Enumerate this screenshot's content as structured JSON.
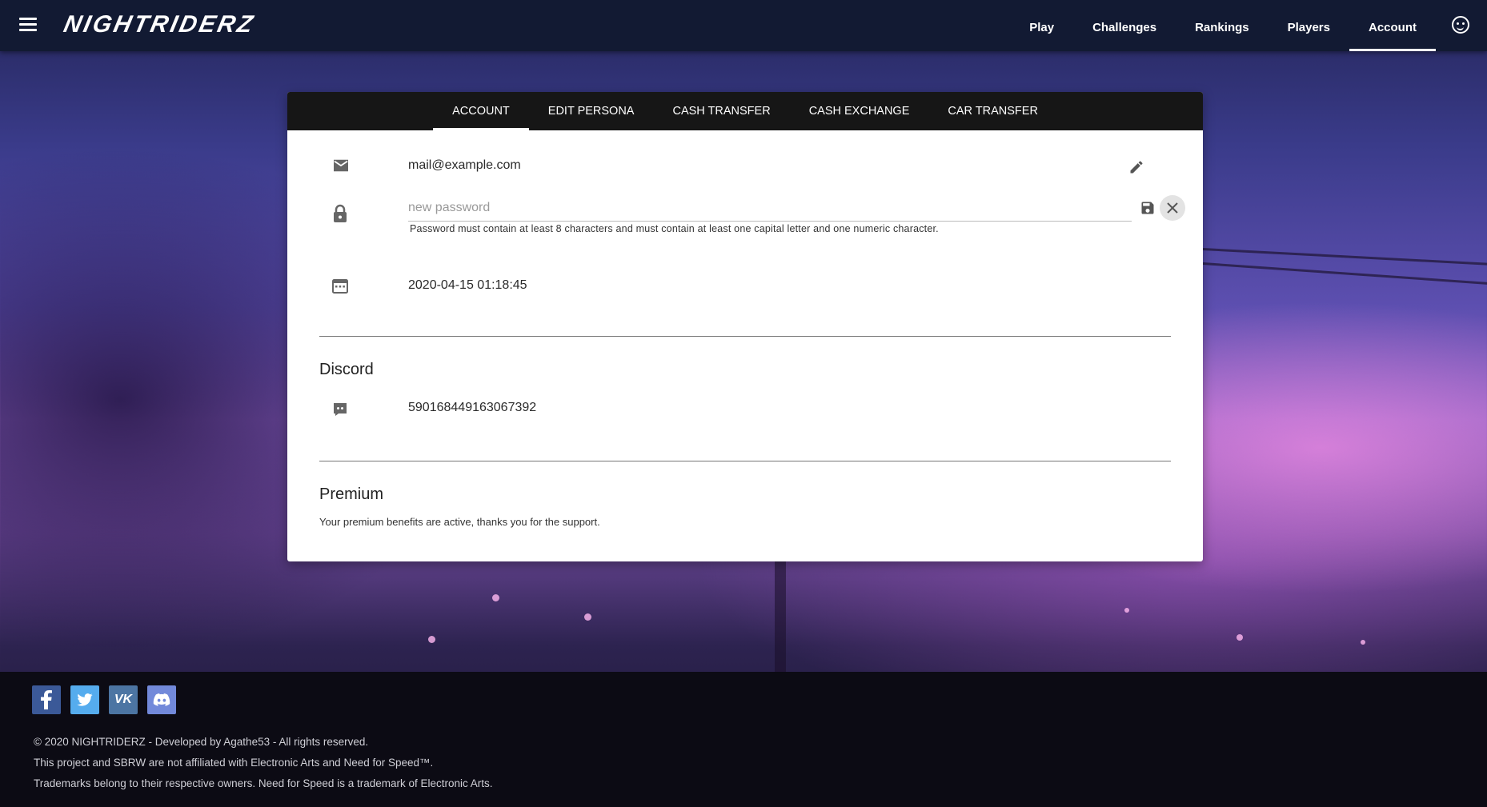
{
  "header": {
    "logo": "NIGHTRIDERZ",
    "nav": [
      {
        "label": "Play"
      },
      {
        "label": "Challenges"
      },
      {
        "label": "Rankings"
      },
      {
        "label": "Players"
      },
      {
        "label": "Account",
        "active": true
      }
    ]
  },
  "tabs": [
    {
      "label": "ACCOUNT",
      "active": true
    },
    {
      "label": "EDIT PERSONA"
    },
    {
      "label": "CASH TRANSFER"
    },
    {
      "label": "CASH EXCHANGE"
    },
    {
      "label": "CAR TRANSFER"
    }
  ],
  "account": {
    "email": "mail@example.com",
    "password_placeholder": "new password",
    "password_value": "",
    "password_hint": "Password must contain at least 8 characters and must contain at least one capital letter and one numeric character.",
    "created": "2020-04-15 01:18:45"
  },
  "discord": {
    "title": "Discord",
    "id": "590168449163067392"
  },
  "premium": {
    "title": "Premium",
    "text": "Your premium benefits are active, thanks you for the support."
  },
  "footer": {
    "socials": [
      {
        "name": "facebook-icon",
        "glyph": "f",
        "color": "#3b5998"
      },
      {
        "name": "twitter-icon",
        "glyph": "t",
        "color": "#55acee"
      },
      {
        "name": "vk-icon",
        "glyph": "vk",
        "color": "#4c75a3"
      },
      {
        "name": "discord-icon",
        "glyph": "d",
        "color": "#7289da"
      }
    ],
    "lines": [
      "© 2020 NIGHTRIDERZ - Developed by Agathe53 - All rights reserved.",
      "This project and SBRW are not affiliated with Electronic Arts and Need for Speed™.",
      "Trademarks belong to their respective owners. Need for Speed is a trademark of Electronic Arts."
    ]
  },
  "colors": {
    "topbar": "#121a33",
    "tabs_bg": "#161616",
    "card_bg": "#ffffff",
    "footer_bg": "#0c0b14"
  }
}
